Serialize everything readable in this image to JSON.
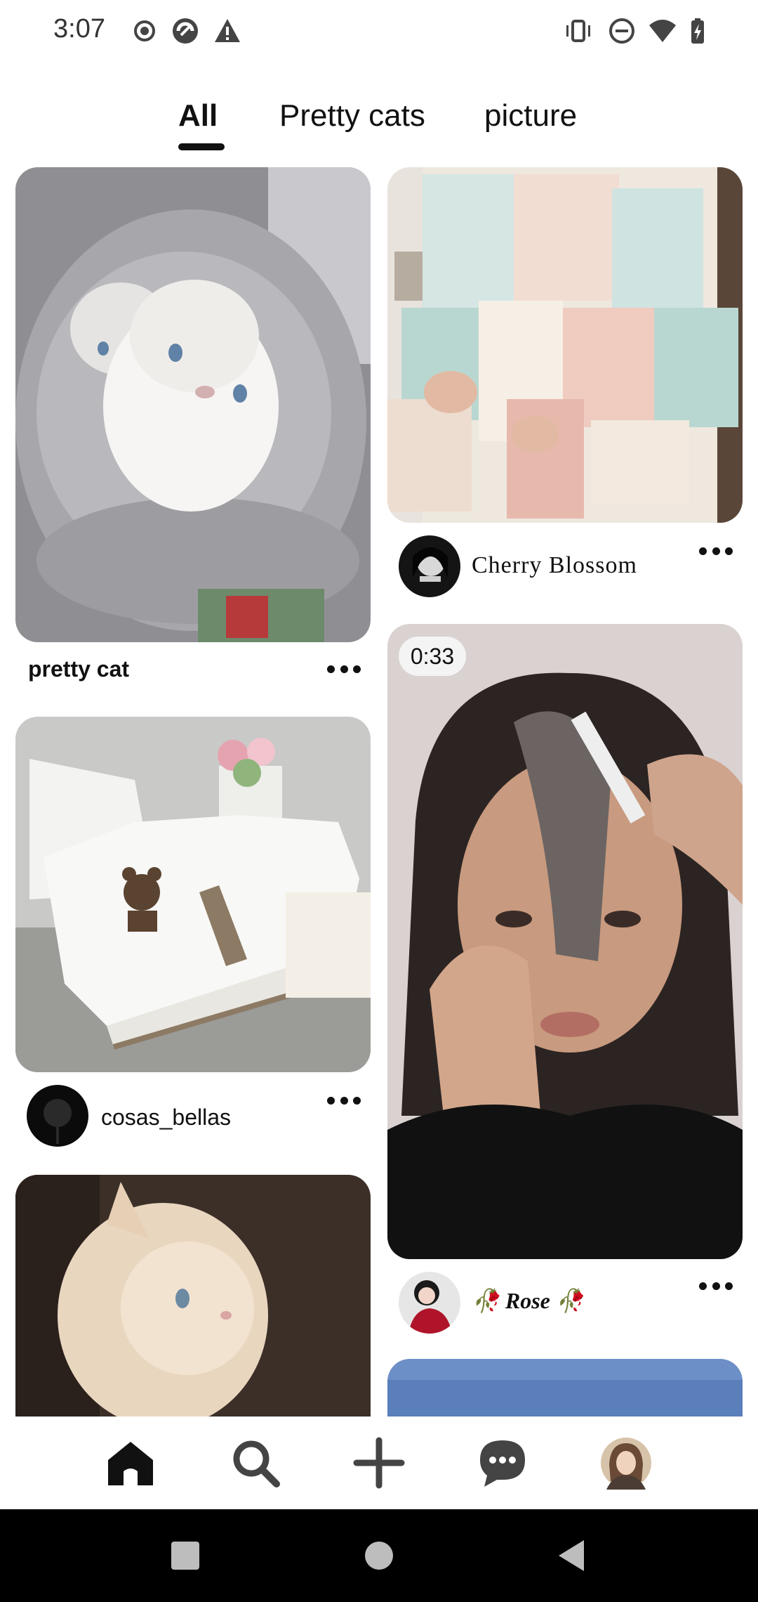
{
  "status_bar": {
    "time": "3:07",
    "icons": [
      "record-icon",
      "app-icon",
      "warning-icon",
      "vibrate-icon",
      "do-not-disturb-icon",
      "wifi-icon",
      "battery-charging-icon"
    ]
  },
  "tabs": [
    {
      "label": "All",
      "active": true
    },
    {
      "label": "Pretty cats",
      "active": false
    },
    {
      "label": "picture",
      "active": false
    }
  ],
  "pins": {
    "kitten": {
      "caption": "pretty cat"
    },
    "cardigan": {
      "author": "Cherry Blossom"
    },
    "shoes": {
      "author": "cosas_bellas"
    },
    "hair_video": {
      "duration": "0:33",
      "author": "Rose"
    }
  },
  "bottom_nav": [
    "home-icon",
    "search-icon",
    "add-icon",
    "messages-icon",
    "profile-avatar"
  ],
  "colors": {
    "accent": "#111111",
    "background": "#ffffff",
    "rose_red": "#c8102e"
  }
}
